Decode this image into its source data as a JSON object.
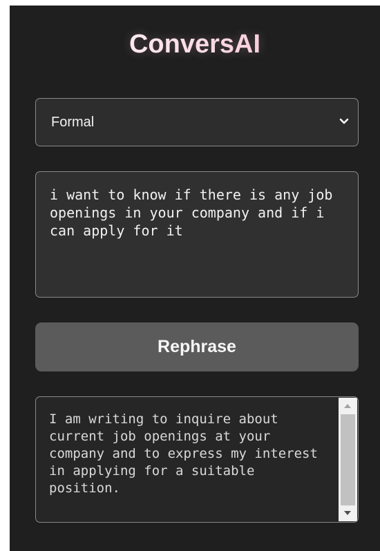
{
  "app": {
    "title": "ConversAI"
  },
  "tone_select": {
    "selected": "Formal",
    "icon": "chevron-down-icon"
  },
  "input": {
    "value": "i want to know if there is any job openings in your company and if i can apply for it"
  },
  "actions": {
    "rephrase_label": "Rephrase"
  },
  "output": {
    "value": "I am writing to inquire about current job openings at your company and to express my interest in applying for a suitable position."
  },
  "colors": {
    "panel_background": "#1f1f1f",
    "field_border": "#8a8a8a",
    "button_background": "#5b5b5b",
    "title_gradient_end": "#f2b5c9"
  }
}
